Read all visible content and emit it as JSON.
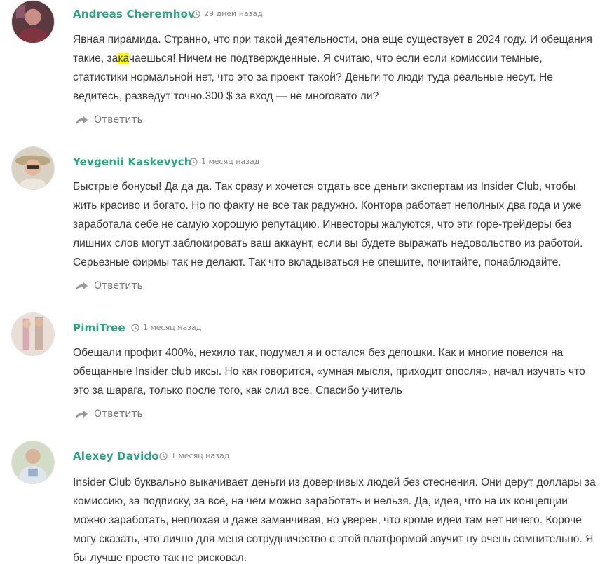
{
  "reply_label": "Ответить",
  "colors": {
    "author": "#2aa581",
    "highlight": "#ffff00"
  },
  "comments": [
    {
      "author": "Andreas Cheremhov",
      "date": "29 дней назад",
      "text_before": "Явная пирамида. Странно, что при такой деятельности, она еще существует в 2024 году. И обещания такие, за",
      "text_highlight": "ка",
      "text_after": "чаешься! Ничем не подтвержденные. Я считаю, что если если комиссии темные, статистики нормальной нет, что это за проект такой? Деньги то люди туда реальные несут. Не ведитесь, разведут точно.300 $ за вход — не многовато ли?"
    },
    {
      "author": "Yevgenii Kaskevych",
      "date": "1 месяц назад",
      "text": "Быстрые бонусы! Да да да. Так сразу и хочется отдать все деньги экспертам из Insider Club, чтобы жить красиво и богато. Но по факту не все так радужно. Контора работает неполных два года и уже заработала себе не самую хорошую репутацию. Инвесторы жалуются, что эти горе-трейдеры без лишних слов могут заблокировать ваш аккаунт, если вы будете выражать недовольство из работой. Серьезные фирмы так не делают. Так что вкладываться не спешите, почитайте, понаблюдайте."
    },
    {
      "author": "PimiTree",
      "date": "1 месяц назад",
      "text": "Обещали профит 400%, нехило так, подумал я и остался без депошки. Как и многие повелся на обещанные Insider club иксы. Но как говорится, «умная мысля, приходит опосля», начал изучать что это за шарага, только после того, как слил все. Спасибо учитель"
    },
    {
      "author": "Alexey Davido",
      "date": "1 месяц назад",
      "text": "Insider Club буквально выкачивает деньги из доверчивых людей без стеснения. Они дерут доллары за комиссию, за подписку, за всё, на чём можно заработать и нельзя. Да, идея, что на их концепции можно заработать, неплохая и даже заманчивая, но уверен, что кроме идеи там нет ничего. Короче могу сказать, что лично для меня сотрудничество с этой платформой звучит ну очень сомнительно. Я бы лучше просто так не рисковал."
    }
  ]
}
